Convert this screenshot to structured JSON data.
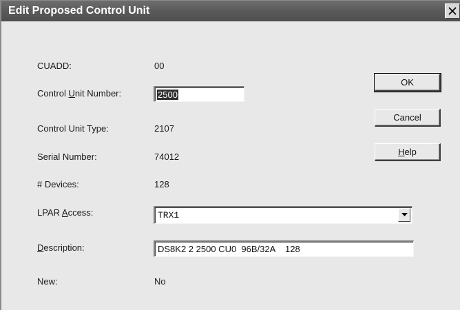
{
  "window": {
    "title": "Edit Proposed Control Unit"
  },
  "fields": {
    "cuadd": {
      "label": "CUADD:",
      "value": "00"
    },
    "control_unit_number": {
      "label_prefix": "Control ",
      "label_accel": "U",
      "label_suffix": "nit Number:",
      "value": "2500"
    },
    "control_unit_type": {
      "label": "Control Unit Type:",
      "value": "2107"
    },
    "serial_number": {
      "label": "Serial Number:",
      "value": "74012"
    },
    "devices": {
      "label": "# Devices:",
      "value": "128"
    },
    "lpar_access": {
      "label_prefix": "LPAR ",
      "label_accel": "A",
      "label_suffix": "ccess:",
      "value": "TRX1"
    },
    "description": {
      "label_accel": "D",
      "label_suffix": "escription:",
      "value": "DS8K2 2 2500 CU0  96B/32A    128"
    },
    "new": {
      "label": "New:",
      "value": "No"
    }
  },
  "buttons": {
    "ok": "OK",
    "cancel": "Cancel",
    "help_accel": "H",
    "help_suffix": "elp"
  },
  "icons": {
    "close": "close-icon",
    "dropdown": "chevron-down-icon"
  }
}
